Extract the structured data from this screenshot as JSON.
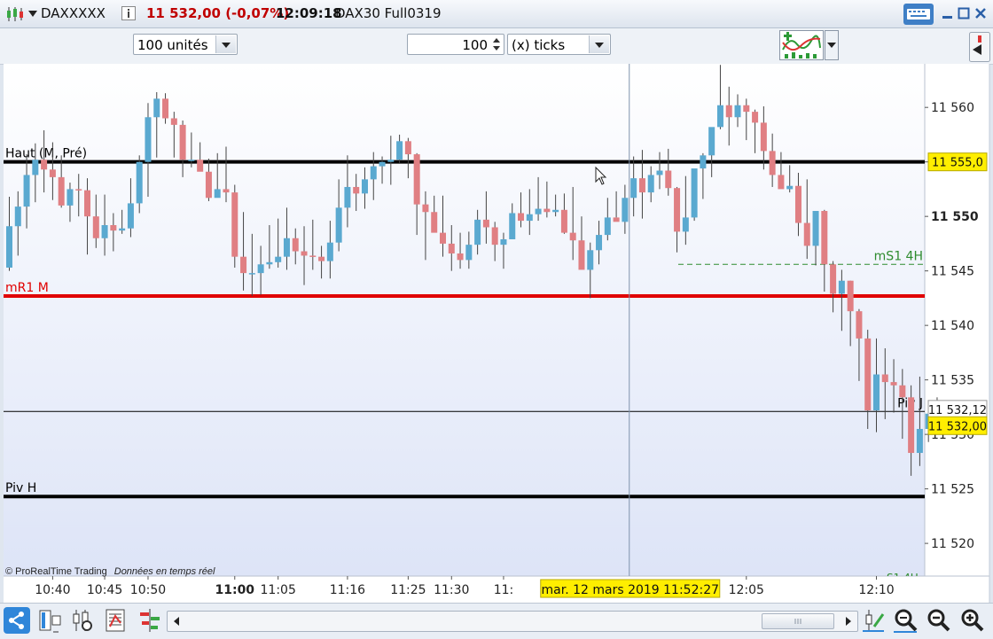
{
  "window": {
    "symbol": "DAXXXXX",
    "last_price": "11 532,00 (-0,07%)",
    "time": "12:09:18",
    "instrument": "DAX30 Full0319"
  },
  "toolbar": {
    "units_value": "100 unités",
    "ticks_count": "100",
    "ticks_unit": "(x) ticks"
  },
  "colors": {
    "up": "#5aa9d0",
    "down": "#e07f83",
    "resistance": "#e00000",
    "level": "#000000",
    "background_top": "#ffffff",
    "background_bottom": "#dfe6f8"
  },
  "chart_data": {
    "type": "candlestick",
    "ylim": [
      11517,
      11564
    ],
    "y_ticks": [
      {
        "value": 11560,
        "label": "11 560",
        "bold": false
      },
      {
        "value": 11555,
        "label": "11 555",
        "bold": false
      },
      {
        "value": 11550,
        "label": "11 550",
        "bold": true
      },
      {
        "value": 11545,
        "label": "11 545",
        "bold": false
      },
      {
        "value": 11540,
        "label": "11 540",
        "bold": false
      },
      {
        "value": 11535,
        "label": "11 535",
        "bold": false
      },
      {
        "value": 11530,
        "label": "11 530",
        "bold": false
      },
      {
        "value": 11525,
        "label": "11 525",
        "bold": false
      },
      {
        "value": 11520,
        "label": "11 520",
        "bold": false
      }
    ],
    "x_ticks": [
      {
        "index": 5,
        "label": "10:40",
        "bold": false
      },
      {
        "index": 11,
        "label": "10:45",
        "bold": false
      },
      {
        "index": 16,
        "label": "10:50",
        "bold": false
      },
      {
        "index": 26,
        "label": "11:00",
        "bold": true
      },
      {
        "index": 31,
        "label": "11:05",
        "bold": false
      },
      {
        "index": 39,
        "label": "11:16",
        "bold": false
      },
      {
        "index": 46,
        "label": "11:25",
        "bold": false
      },
      {
        "index": 51,
        "label": "11:30",
        "bold": false
      },
      {
        "index": 57,
        "label": "11:",
        "bold": false
      },
      {
        "index": 85,
        "label": "12:05",
        "bold": false
      },
      {
        "index": 100,
        "label": "12:10",
        "bold": false
      }
    ],
    "candles": [
      {
        "o": 11545.3,
        "h": 11551.8,
        "l": 11545.0,
        "c": 11549.1
      },
      {
        "o": 11549.1,
        "h": 11552.3,
        "l": 11546.4,
        "c": 11550.9
      },
      {
        "o": 11550.9,
        "h": 11555.7,
        "l": 11548.9,
        "c": 11553.8
      },
      {
        "o": 11553.8,
        "h": 11556.7,
        "l": 11551.3,
        "c": 11555.2
      },
      {
        "o": 11555.2,
        "h": 11557.9,
        "l": 11552.2,
        "c": 11554.3
      },
      {
        "o": 11554.3,
        "h": 11556.8,
        "l": 11551.5,
        "c": 11553.6
      },
      {
        "o": 11553.6,
        "h": 11555.6,
        "l": 11550.8,
        "c": 11551.0
      },
      {
        "o": 11551.0,
        "h": 11553.1,
        "l": 11549.5,
        "c": 11552.5
      },
      {
        "o": 11552.5,
        "h": 11553.9,
        "l": 11550.0,
        "c": 11552.4
      },
      {
        "o": 11552.4,
        "h": 11553.5,
        "l": 11546.5,
        "c": 11550.0
      },
      {
        "o": 11550.0,
        "h": 11552.0,
        "l": 11547.1,
        "c": 11548.0
      },
      {
        "o": 11548.0,
        "h": 11552.0,
        "l": 11546.4,
        "c": 11549.2
      },
      {
        "o": 11549.2,
        "h": 11550.3,
        "l": 11546.8,
        "c": 11548.7
      },
      {
        "o": 11548.7,
        "h": 11550.6,
        "l": 11548.4,
        "c": 11548.9
      },
      {
        "o": 11548.9,
        "h": 11553.5,
        "l": 11548.1,
        "c": 11551.2
      },
      {
        "o": 11551.2,
        "h": 11555.6,
        "l": 11550.3,
        "c": 11555.0
      },
      {
        "o": 11555.0,
        "h": 11560.4,
        "l": 11551.8,
        "c": 11559.1
      },
      {
        "o": 11559.1,
        "h": 11561.4,
        "l": 11555.4,
        "c": 11560.8
      },
      {
        "o": 11560.8,
        "h": 11561.3,
        "l": 11558.5,
        "c": 11559.0
      },
      {
        "o": 11559.0,
        "h": 11559.6,
        "l": 11555.4,
        "c": 11558.4
      },
      {
        "o": 11558.4,
        "h": 11558.8,
        "l": 11553.6,
        "c": 11555.2
      },
      {
        "o": 11555.2,
        "h": 11557.7,
        "l": 11554.5,
        "c": 11555.2
      },
      {
        "o": 11555.2,
        "h": 11556.8,
        "l": 11554.6,
        "c": 11554.1
      },
      {
        "o": 11554.1,
        "h": 11555.3,
        "l": 11551.4,
        "c": 11551.7
      },
      {
        "o": 11551.7,
        "h": 11555.8,
        "l": 11551.8,
        "c": 11552.5
      },
      {
        "o": 11552.5,
        "h": 11556.4,
        "l": 11551.3,
        "c": 11552.2
      },
      {
        "o": 11552.2,
        "h": 11552.9,
        "l": 11545.3,
        "c": 11546.3
      },
      {
        "o": 11546.3,
        "h": 11550.4,
        "l": 11543.2,
        "c": 11544.8
      },
      {
        "o": 11544.8,
        "h": 11548.4,
        "l": 11542.7,
        "c": 11544.8
      },
      {
        "o": 11544.8,
        "h": 11547.3,
        "l": 11542.8,
        "c": 11545.6
      },
      {
        "o": 11545.6,
        "h": 11549.2,
        "l": 11545.2,
        "c": 11545.8
      },
      {
        "o": 11545.8,
        "h": 11549.8,
        "l": 11545.3,
        "c": 11546.3
      },
      {
        "o": 11546.3,
        "h": 11550.8,
        "l": 11545.1,
        "c": 11548.0
      },
      {
        "o": 11548.0,
        "h": 11548.9,
        "l": 11545.6,
        "c": 11546.8
      },
      {
        "o": 11546.8,
        "h": 11549.1,
        "l": 11543.7,
        "c": 11546.4
      },
      {
        "o": 11546.4,
        "h": 11549.7,
        "l": 11545.1,
        "c": 11546.3
      },
      {
        "o": 11546.3,
        "h": 11547.3,
        "l": 11544.3,
        "c": 11545.9
      },
      {
        "o": 11545.9,
        "h": 11549.6,
        "l": 11544.3,
        "c": 11547.6
      },
      {
        "o": 11547.6,
        "h": 11553.4,
        "l": 11546.8,
        "c": 11550.8
      },
      {
        "o": 11550.8,
        "h": 11555.6,
        "l": 11549.0,
        "c": 11552.7
      },
      {
        "o": 11552.7,
        "h": 11553.9,
        "l": 11550.5,
        "c": 11552.1
      },
      {
        "o": 11552.1,
        "h": 11554.5,
        "l": 11550.7,
        "c": 11553.4
      },
      {
        "o": 11553.4,
        "h": 11555.9,
        "l": 11551.5,
        "c": 11554.6
      },
      {
        "o": 11554.6,
        "h": 11555.5,
        "l": 11553.0,
        "c": 11555.0
      },
      {
        "o": 11555.0,
        "h": 11557.4,
        "l": 11552.9,
        "c": 11555.2
      },
      {
        "o": 11555.2,
        "h": 11557.5,
        "l": 11554.9,
        "c": 11556.9
      },
      {
        "o": 11556.9,
        "h": 11557.2,
        "l": 11553.5,
        "c": 11555.7
      },
      {
        "o": 11555.7,
        "h": 11555.8,
        "l": 11548.3,
        "c": 11551.1
      },
      {
        "o": 11551.1,
        "h": 11552.3,
        "l": 11546.0,
        "c": 11550.4
      },
      {
        "o": 11550.4,
        "h": 11551.9,
        "l": 11548.9,
        "c": 11548.5
      },
      {
        "o": 11548.5,
        "h": 11551.9,
        "l": 11546.3,
        "c": 11547.5
      },
      {
        "o": 11547.5,
        "h": 11549.2,
        "l": 11545.0,
        "c": 11546.6
      },
      {
        "o": 11546.6,
        "h": 11548.5,
        "l": 11545.2,
        "c": 11546.0
      },
      {
        "o": 11546.0,
        "h": 11548.6,
        "l": 11545.2,
        "c": 11547.4
      },
      {
        "o": 11547.4,
        "h": 11550.6,
        "l": 11546.5,
        "c": 11549.7
      },
      {
        "o": 11549.7,
        "h": 11552.3,
        "l": 11547.5,
        "c": 11549.0
      },
      {
        "o": 11549.0,
        "h": 11549.5,
        "l": 11545.9,
        "c": 11547.4
      },
      {
        "o": 11547.4,
        "h": 11548.5,
        "l": 11545.2,
        "c": 11547.9
      },
      {
        "o": 11547.9,
        "h": 11551.2,
        "l": 11547.9,
        "c": 11550.3
      },
      {
        "o": 11550.3,
        "h": 11552.2,
        "l": 11549.0,
        "c": 11549.6
      },
      {
        "o": 11549.6,
        "h": 11552.5,
        "l": 11548.3,
        "c": 11550.2
      },
      {
        "o": 11550.2,
        "h": 11553.6,
        "l": 11549.6,
        "c": 11550.7
      },
      {
        "o": 11550.7,
        "h": 11553.2,
        "l": 11549.9,
        "c": 11550.4
      },
      {
        "o": 11550.4,
        "h": 11552.0,
        "l": 11550.0,
        "c": 11550.6
      },
      {
        "o": 11550.6,
        "h": 11552.1,
        "l": 11548.4,
        "c": 11548.5
      },
      {
        "o": 11548.5,
        "h": 11552.7,
        "l": 11546.0,
        "c": 11547.8
      },
      {
        "o": 11547.8,
        "h": 11550.0,
        "l": 11545.6,
        "c": 11545.1
      },
      {
        "o": 11545.1,
        "h": 11547.6,
        "l": 11542.5,
        "c": 11546.9
      },
      {
        "o": 11546.9,
        "h": 11549.6,
        "l": 11545.6,
        "c": 11548.3
      },
      {
        "o": 11548.3,
        "h": 11551.7,
        "l": 11547.8,
        "c": 11549.9
      },
      {
        "o": 11549.9,
        "h": 11552.3,
        "l": 11549.9,
        "c": 11549.5
      },
      {
        "o": 11549.5,
        "h": 11552.9,
        "l": 11548.4,
        "c": 11551.7
      },
      {
        "o": 11551.7,
        "h": 11555.5,
        "l": 11550.0,
        "c": 11553.5
      },
      {
        "o": 11553.5,
        "h": 11556.1,
        "l": 11549.8,
        "c": 11552.2
      },
      {
        "o": 11552.2,
        "h": 11554.6,
        "l": 11551.3,
        "c": 11553.8
      },
      {
        "o": 11553.8,
        "h": 11555.9,
        "l": 11552.5,
        "c": 11554.2
      },
      {
        "o": 11554.2,
        "h": 11556.2,
        "l": 11551.9,
        "c": 11552.6
      },
      {
        "o": 11552.6,
        "h": 11552.7,
        "l": 11546.7,
        "c": 11548.6
      },
      {
        "o": 11548.6,
        "h": 11553.7,
        "l": 11547.4,
        "c": 11549.9
      },
      {
        "o": 11549.9,
        "h": 11553.7,
        "l": 11549.6,
        "c": 11554.4
      },
      {
        "o": 11554.4,
        "h": 11555.8,
        "l": 11551.6,
        "c": 11555.6
      },
      {
        "o": 11555.6,
        "h": 11556.7,
        "l": 11553.6,
        "c": 11558.2
      },
      {
        "o": 11558.2,
        "h": 11563.9,
        "l": 11558.0,
        "c": 11560.2
      },
      {
        "o": 11560.2,
        "h": 11561.9,
        "l": 11556.5,
        "c": 11559.1
      },
      {
        "o": 11559.1,
        "h": 11561.2,
        "l": 11558.2,
        "c": 11560.2
      },
      {
        "o": 11560.2,
        "h": 11560.8,
        "l": 11557.0,
        "c": 11559.6
      },
      {
        "o": 11559.6,
        "h": 11559.8,
        "l": 11555.8,
        "c": 11558.6
      },
      {
        "o": 11558.6,
        "h": 11560.1,
        "l": 11554.3,
        "c": 11556.0
      },
      {
        "o": 11556.0,
        "h": 11557.6,
        "l": 11552.7,
        "c": 11553.8
      },
      {
        "o": 11553.8,
        "h": 11555.9,
        "l": 11553.3,
        "c": 11552.5
      },
      {
        "o": 11552.5,
        "h": 11554.7,
        "l": 11552.2,
        "c": 11552.8
      },
      {
        "o": 11552.8,
        "h": 11554.0,
        "l": 11548.2,
        "c": 11549.4
      },
      {
        "o": 11549.4,
        "h": 11553.4,
        "l": 11546.1,
        "c": 11547.3
      },
      {
        "o": 11547.3,
        "h": 11549.5,
        "l": 11545.5,
        "c": 11550.5
      },
      {
        "o": 11550.5,
        "h": 11550.6,
        "l": 11543.1,
        "c": 11545.6
      },
      {
        "o": 11545.6,
        "h": 11545.9,
        "l": 11541.2,
        "c": 11542.9
      },
      {
        "o": 11542.9,
        "h": 11545.1,
        "l": 11539.5,
        "c": 11544.1
      },
      {
        "o": 11544.1,
        "h": 11544.1,
        "l": 11538.1,
        "c": 11541.3
      },
      {
        "o": 11541.3,
        "h": 11541.5,
        "l": 11534.9,
        "c": 11538.8
      },
      {
        "o": 11538.8,
        "h": 11539.6,
        "l": 11530.5,
        "c": 11532.2
      },
      {
        "o": 11532.2,
        "h": 11538.8,
        "l": 11530.2,
        "c": 11535.5
      },
      {
        "o": 11535.5,
        "h": 11537.9,
        "l": 11531.4,
        "c": 11534.8
      },
      {
        "o": 11534.8,
        "h": 11536.9,
        "l": 11532.0,
        "c": 11534.5
      },
      {
        "o": 11534.5,
        "h": 11536.0,
        "l": 11529.6,
        "c": 11533.4
      },
      {
        "o": 11533.4,
        "h": 11534.5,
        "l": 11526.2,
        "c": 11528.3
      },
      {
        "o": 11528.3,
        "h": 11535.3,
        "l": 11527.1,
        "c": 11530.5
      },
      {
        "o": 11530.5,
        "h": 11532.5,
        "l": 11529.3,
        "c": 11531.9
      },
      {
        "o": 11531.9,
        "h": 11533.4,
        "l": 11531.5,
        "c": 11532.6
      }
    ],
    "levels": [
      {
        "label": "Haut (M, Pré)",
        "value": 11555.0,
        "color": "#000000",
        "style": "solid-thick"
      },
      {
        "label": "mR1 M",
        "value": 11542.7,
        "color": "#e00000",
        "style": "solid-thick"
      },
      {
        "label": "mS1 4H",
        "value": 11545.6,
        "color": "#2e8b2e",
        "style": "dashed"
      },
      {
        "label": "Piv J",
        "value": 11532.1,
        "color": "#000000",
        "style": "solid-thin"
      },
      {
        "label": "Piv H",
        "value": 11524.3,
        "color": "#000000",
        "style": "solid-thick"
      }
    ],
    "price_tags": [
      {
        "label": "11 555,0",
        "value": 11555.0,
        "style": "yellow"
      },
      {
        "label": "11 532,12",
        "value": 11532.3,
        "style": "white"
      },
      {
        "label": "11 532,00",
        "value": 11530.8,
        "style": "yellow"
      }
    ],
    "crosshair": {
      "index": 71.5,
      "label": "mar. 12 mars 2019 11:52:27"
    },
    "partial_label": "S1 4H",
    "copyright": "© ProRealTime Trading",
    "realtime_note": "Données en temps réel"
  }
}
